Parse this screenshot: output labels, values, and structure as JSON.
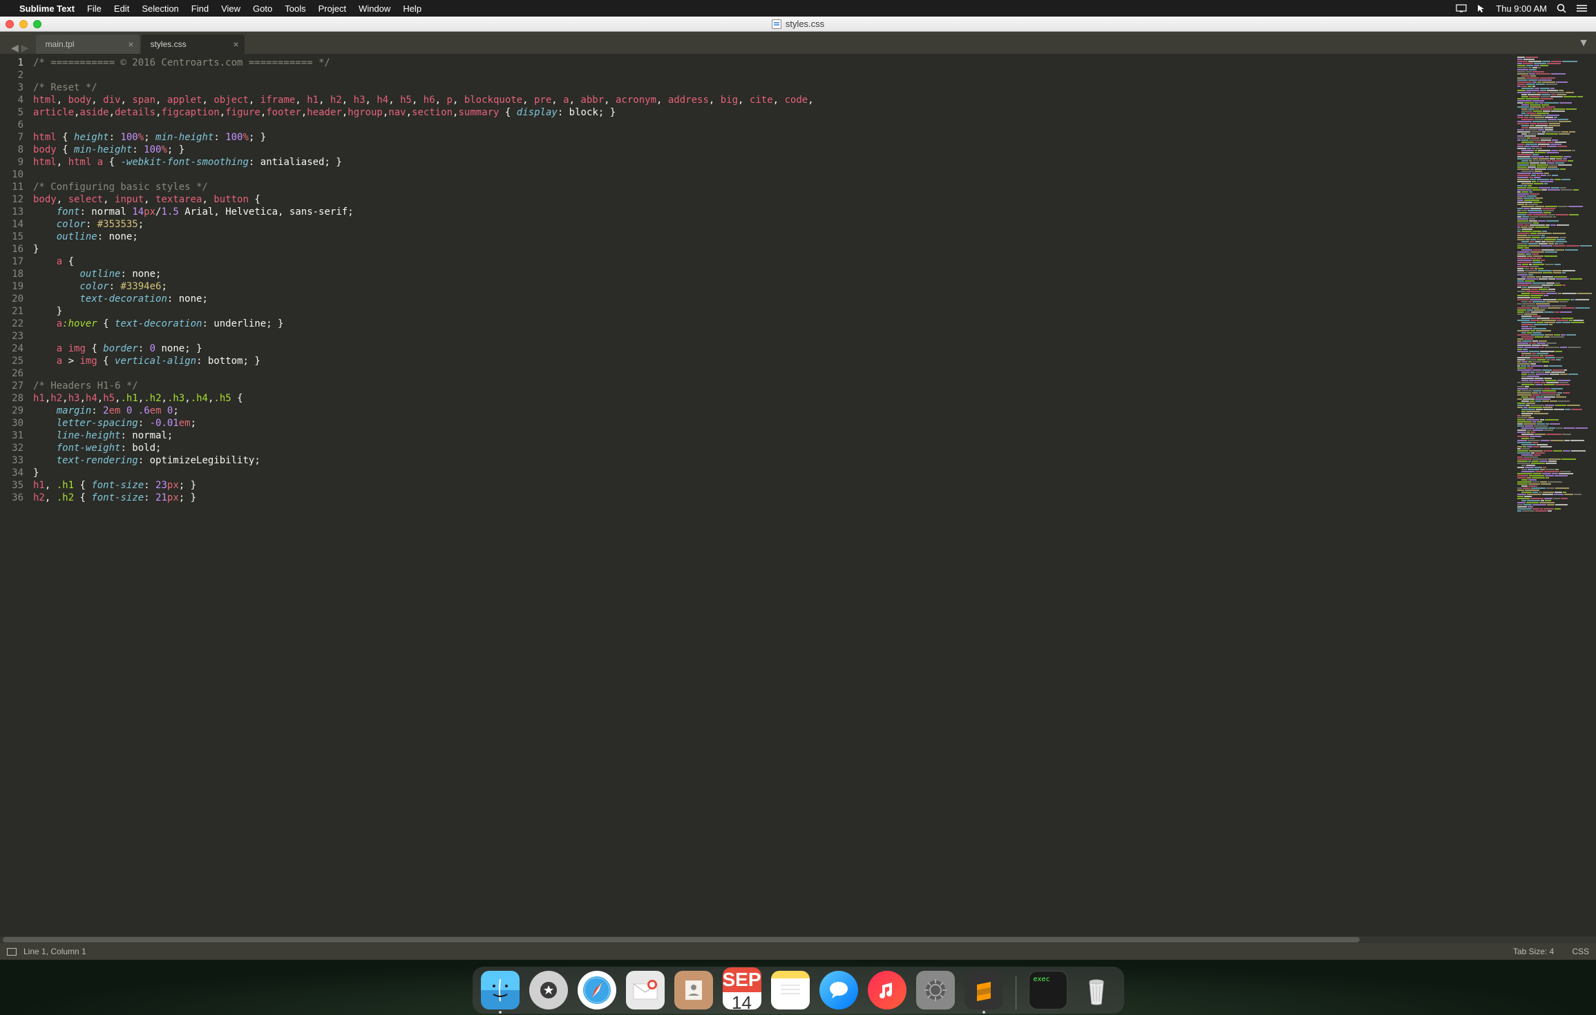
{
  "menubar": {
    "app_name": "Sublime Text",
    "items": [
      "File",
      "Edit",
      "Selection",
      "Find",
      "View",
      "Goto",
      "Tools",
      "Project",
      "Window",
      "Help"
    ],
    "clock": "Thu 9:00 AM"
  },
  "window": {
    "title": "styles.css"
  },
  "tabs": [
    {
      "label": "main.tpl",
      "active": false
    },
    {
      "label": "styles.css",
      "active": true
    }
  ],
  "lines": [
    {
      "n": 1,
      "tokens": [
        [
          "cmt",
          "/* =========== © 2016 Centroarts.com =========== */"
        ]
      ]
    },
    {
      "n": 2,
      "tokens": []
    },
    {
      "n": 3,
      "tokens": [
        [
          "cmt",
          "/* Reset */"
        ]
      ]
    },
    {
      "n": 4,
      "tokens": [
        [
          "sel",
          "html"
        ],
        [
          "punc",
          ", "
        ],
        [
          "sel",
          "body"
        ],
        [
          "punc",
          ", "
        ],
        [
          "sel",
          "div"
        ],
        [
          "punc",
          ", "
        ],
        [
          "sel",
          "span"
        ],
        [
          "punc",
          ", "
        ],
        [
          "sel",
          "applet"
        ],
        [
          "punc",
          ", "
        ],
        [
          "sel",
          "object"
        ],
        [
          "punc",
          ", "
        ],
        [
          "sel",
          "iframe"
        ],
        [
          "punc",
          ", "
        ],
        [
          "sel",
          "h1"
        ],
        [
          "punc",
          ", "
        ],
        [
          "sel",
          "h2"
        ],
        [
          "punc",
          ", "
        ],
        [
          "sel",
          "h3"
        ],
        [
          "punc",
          ", "
        ],
        [
          "sel",
          "h4"
        ],
        [
          "punc",
          ", "
        ],
        [
          "sel",
          "h5"
        ],
        [
          "punc",
          ", "
        ],
        [
          "sel",
          "h6"
        ],
        [
          "punc",
          ", "
        ],
        [
          "sel",
          "p"
        ],
        [
          "punc",
          ", "
        ],
        [
          "sel",
          "blockquote"
        ],
        [
          "punc",
          ", "
        ],
        [
          "sel",
          "pre"
        ],
        [
          "punc",
          ", "
        ],
        [
          "sel",
          "a"
        ],
        [
          "punc",
          ", "
        ],
        [
          "sel",
          "abbr"
        ],
        [
          "punc",
          ", "
        ],
        [
          "sel",
          "acronym"
        ],
        [
          "punc",
          ", "
        ],
        [
          "sel",
          "address"
        ],
        [
          "punc",
          ", "
        ],
        [
          "sel",
          "big"
        ],
        [
          "punc",
          ", "
        ],
        [
          "sel",
          "cite"
        ],
        [
          "punc",
          ", "
        ],
        [
          "sel",
          "code"
        ],
        [
          "punc",
          ", "
        ]
      ]
    },
    {
      "n": 5,
      "tokens": [
        [
          "sel",
          "article"
        ],
        [
          "punc",
          ","
        ],
        [
          "sel",
          "aside"
        ],
        [
          "punc",
          ","
        ],
        [
          "sel",
          "details"
        ],
        [
          "punc",
          ","
        ],
        [
          "sel",
          "figcaption"
        ],
        [
          "punc",
          ","
        ],
        [
          "sel",
          "figure"
        ],
        [
          "punc",
          ","
        ],
        [
          "sel",
          "footer"
        ],
        [
          "punc",
          ","
        ],
        [
          "sel",
          "header"
        ],
        [
          "punc",
          ","
        ],
        [
          "sel",
          "hgroup"
        ],
        [
          "punc",
          ","
        ],
        [
          "sel",
          "nav"
        ],
        [
          "punc",
          ","
        ],
        [
          "sel",
          "section"
        ],
        [
          "punc",
          ","
        ],
        [
          "sel",
          "summary"
        ],
        [
          "brace",
          " { "
        ],
        [
          "prop",
          "display"
        ],
        [
          "punc",
          ": "
        ],
        [
          "val",
          "block"
        ],
        [
          "punc",
          "; "
        ],
        [
          "brace",
          "}"
        ]
      ]
    },
    {
      "n": 6,
      "tokens": []
    },
    {
      "n": 7,
      "tokens": [
        [
          "sel",
          "html"
        ],
        [
          "brace",
          " { "
        ],
        [
          "prop",
          "height"
        ],
        [
          "punc",
          ": "
        ],
        [
          "num",
          "100"
        ],
        [
          "unit",
          "%"
        ],
        [
          "punc",
          "; "
        ],
        [
          "prop",
          "min-height"
        ],
        [
          "punc",
          ": "
        ],
        [
          "num",
          "100"
        ],
        [
          "unit",
          "%"
        ],
        [
          "punc",
          "; "
        ],
        [
          "brace",
          "}"
        ]
      ]
    },
    {
      "n": 8,
      "tokens": [
        [
          "sel",
          "body"
        ],
        [
          "brace",
          " { "
        ],
        [
          "prop",
          "min-height"
        ],
        [
          "punc",
          ": "
        ],
        [
          "num",
          "100"
        ],
        [
          "unit",
          "%"
        ],
        [
          "punc",
          "; "
        ],
        [
          "brace",
          "}"
        ]
      ]
    },
    {
      "n": 9,
      "tokens": [
        [
          "sel",
          "html"
        ],
        [
          "punc",
          ", "
        ],
        [
          "sel",
          "html"
        ],
        [
          "punc",
          " "
        ],
        [
          "sel",
          "a"
        ],
        [
          "brace",
          " { "
        ],
        [
          "prop",
          "-webkit-font-smoothing"
        ],
        [
          "punc",
          ": "
        ],
        [
          "val",
          "antialiased"
        ],
        [
          "punc",
          "; "
        ],
        [
          "brace",
          "}"
        ]
      ]
    },
    {
      "n": 10,
      "tokens": []
    },
    {
      "n": 11,
      "tokens": [
        [
          "cmt",
          "/* Configuring basic styles */"
        ]
      ]
    },
    {
      "n": 12,
      "tokens": [
        [
          "sel",
          "body"
        ],
        [
          "punc",
          ", "
        ],
        [
          "sel",
          "select"
        ],
        [
          "punc",
          ", "
        ],
        [
          "sel",
          "input"
        ],
        [
          "punc",
          ", "
        ],
        [
          "sel",
          "textarea"
        ],
        [
          "punc",
          ", "
        ],
        [
          "sel",
          "button"
        ],
        [
          "brace",
          " {"
        ]
      ]
    },
    {
      "n": 13,
      "tokens": [
        [
          "punc",
          "    "
        ],
        [
          "prop",
          "font"
        ],
        [
          "punc",
          ": "
        ],
        [
          "val",
          "normal "
        ],
        [
          "num",
          "14"
        ],
        [
          "unit",
          "px"
        ],
        [
          "punc",
          "/"
        ],
        [
          "num",
          "1.5"
        ],
        [
          "val",
          " Arial, Helvetica, sans-serif"
        ],
        [
          "punc",
          ";"
        ]
      ]
    },
    {
      "n": 14,
      "tokens": [
        [
          "punc",
          "    "
        ],
        [
          "prop",
          "color"
        ],
        [
          "punc",
          ": "
        ],
        [
          "hex",
          "#353535"
        ],
        [
          "punc",
          ";"
        ]
      ]
    },
    {
      "n": 15,
      "tokens": [
        [
          "punc",
          "    "
        ],
        [
          "prop",
          "outline"
        ],
        [
          "punc",
          ": "
        ],
        [
          "val",
          "none"
        ],
        [
          "punc",
          ";"
        ]
      ]
    },
    {
      "n": 16,
      "tokens": [
        [
          "brace",
          "}"
        ]
      ]
    },
    {
      "n": 17,
      "tokens": [
        [
          "punc",
          "    "
        ],
        [
          "sel",
          "a"
        ],
        [
          "brace",
          " {"
        ]
      ]
    },
    {
      "n": 18,
      "tokens": [
        [
          "punc",
          "        "
        ],
        [
          "prop",
          "outline"
        ],
        [
          "punc",
          ": "
        ],
        [
          "val",
          "none"
        ],
        [
          "punc",
          ";"
        ]
      ]
    },
    {
      "n": 19,
      "tokens": [
        [
          "punc",
          "        "
        ],
        [
          "prop",
          "color"
        ],
        [
          "punc",
          ": "
        ],
        [
          "hex",
          "#3394e6"
        ],
        [
          "punc",
          ";"
        ]
      ]
    },
    {
      "n": 20,
      "tokens": [
        [
          "punc",
          "        "
        ],
        [
          "prop",
          "text-decoration"
        ],
        [
          "punc",
          ": "
        ],
        [
          "val",
          "none"
        ],
        [
          "punc",
          ";"
        ]
      ]
    },
    {
      "n": 21,
      "tokens": [
        [
          "punc",
          "    "
        ],
        [
          "brace",
          "}"
        ]
      ]
    },
    {
      "n": 22,
      "tokens": [
        [
          "punc",
          "    "
        ],
        [
          "sel",
          "a"
        ],
        [
          "pseudo",
          ":hover"
        ],
        [
          "brace",
          " { "
        ],
        [
          "prop",
          "text-decoration"
        ],
        [
          "punc",
          ": "
        ],
        [
          "val",
          "underline"
        ],
        [
          "punc",
          "; "
        ],
        [
          "brace",
          "}"
        ]
      ]
    },
    {
      "n": 23,
      "tokens": []
    },
    {
      "n": 24,
      "tokens": [
        [
          "punc",
          "    "
        ],
        [
          "sel",
          "a"
        ],
        [
          "punc",
          " "
        ],
        [
          "sel",
          "img"
        ],
        [
          "brace",
          " { "
        ],
        [
          "prop",
          "border"
        ],
        [
          "punc",
          ": "
        ],
        [
          "num",
          "0"
        ],
        [
          "val",
          " none"
        ],
        [
          "punc",
          "; "
        ],
        [
          "brace",
          "}"
        ]
      ]
    },
    {
      "n": 25,
      "tokens": [
        [
          "punc",
          "    "
        ],
        [
          "sel",
          "a"
        ],
        [
          "punc",
          " > "
        ],
        [
          "sel",
          "img"
        ],
        [
          "brace",
          " { "
        ],
        [
          "prop",
          "vertical-align"
        ],
        [
          "punc",
          ": "
        ],
        [
          "val",
          "bottom"
        ],
        [
          "punc",
          "; "
        ],
        [
          "brace",
          "}"
        ]
      ]
    },
    {
      "n": 26,
      "tokens": []
    },
    {
      "n": 27,
      "tokens": [
        [
          "cmt",
          "/* Headers H1-6 */"
        ]
      ]
    },
    {
      "n": 28,
      "tokens": [
        [
          "sel",
          "h1"
        ],
        [
          "punc",
          ","
        ],
        [
          "sel",
          "h2"
        ],
        [
          "punc",
          ","
        ],
        [
          "sel",
          "h3"
        ],
        [
          "punc",
          ","
        ],
        [
          "sel",
          "h4"
        ],
        [
          "punc",
          ","
        ],
        [
          "sel",
          "h5"
        ],
        [
          "punc",
          ","
        ],
        [
          "selclass",
          ".h1"
        ],
        [
          "punc",
          ","
        ],
        [
          "selclass",
          ".h2"
        ],
        [
          "punc",
          ","
        ],
        [
          "selclass",
          ".h3"
        ],
        [
          "punc",
          ","
        ],
        [
          "selclass",
          ".h4"
        ],
        [
          "punc",
          ","
        ],
        [
          "selclass",
          ".h5"
        ],
        [
          "brace",
          " {"
        ]
      ]
    },
    {
      "n": 29,
      "tokens": [
        [
          "punc",
          "    "
        ],
        [
          "prop",
          "margin"
        ],
        [
          "punc",
          ": "
        ],
        [
          "num",
          "2"
        ],
        [
          "unit",
          "em"
        ],
        [
          "punc",
          " "
        ],
        [
          "num",
          "0"
        ],
        [
          "punc",
          " "
        ],
        [
          "num",
          ".6"
        ],
        [
          "unit",
          "em"
        ],
        [
          "punc",
          " "
        ],
        [
          "num",
          "0"
        ],
        [
          "punc",
          ";"
        ]
      ]
    },
    {
      "n": 30,
      "tokens": [
        [
          "punc",
          "    "
        ],
        [
          "prop",
          "letter-spacing"
        ],
        [
          "punc",
          ": "
        ],
        [
          "num",
          "-0.01"
        ],
        [
          "unit",
          "em"
        ],
        [
          "punc",
          ";"
        ]
      ]
    },
    {
      "n": 31,
      "tokens": [
        [
          "punc",
          "    "
        ],
        [
          "prop",
          "line-height"
        ],
        [
          "punc",
          ": "
        ],
        [
          "val",
          "normal"
        ],
        [
          "punc",
          ";"
        ]
      ]
    },
    {
      "n": 32,
      "tokens": [
        [
          "punc",
          "    "
        ],
        [
          "prop",
          "font-weight"
        ],
        [
          "punc",
          ": "
        ],
        [
          "val",
          "bold"
        ],
        [
          "punc",
          ";"
        ]
      ]
    },
    {
      "n": 33,
      "tokens": [
        [
          "punc",
          "    "
        ],
        [
          "prop",
          "text-rendering"
        ],
        [
          "punc",
          ": "
        ],
        [
          "val",
          "optimizeLegibility"
        ],
        [
          "punc",
          ";"
        ]
      ]
    },
    {
      "n": 34,
      "tokens": [
        [
          "brace",
          "}"
        ]
      ]
    },
    {
      "n": 35,
      "tokens": [
        [
          "sel",
          "h1"
        ],
        [
          "punc",
          ", "
        ],
        [
          "selclass",
          ".h1"
        ],
        [
          "brace",
          " { "
        ],
        [
          "prop",
          "font-size"
        ],
        [
          "punc",
          ": "
        ],
        [
          "num",
          "23"
        ],
        [
          "unit",
          "px"
        ],
        [
          "punc",
          "; "
        ],
        [
          "brace",
          "}"
        ]
      ]
    },
    {
      "n": 36,
      "tokens": [
        [
          "sel",
          "h2"
        ],
        [
          "punc",
          ", "
        ],
        [
          "selclass",
          ".h2"
        ],
        [
          "brace",
          " { "
        ],
        [
          "prop",
          "font-size"
        ],
        [
          "punc",
          ": "
        ],
        [
          "num",
          "21"
        ],
        [
          "unit",
          "px"
        ],
        [
          "punc",
          "; "
        ],
        [
          "brace",
          "}"
        ]
      ]
    }
  ],
  "statusbar": {
    "position": "Line 1, Column 1",
    "tab_size": "Tab Size: 4",
    "syntax": "CSS"
  },
  "dock": {
    "calendar_month": "SEP",
    "calendar_day": "14",
    "term_label": "exec"
  }
}
